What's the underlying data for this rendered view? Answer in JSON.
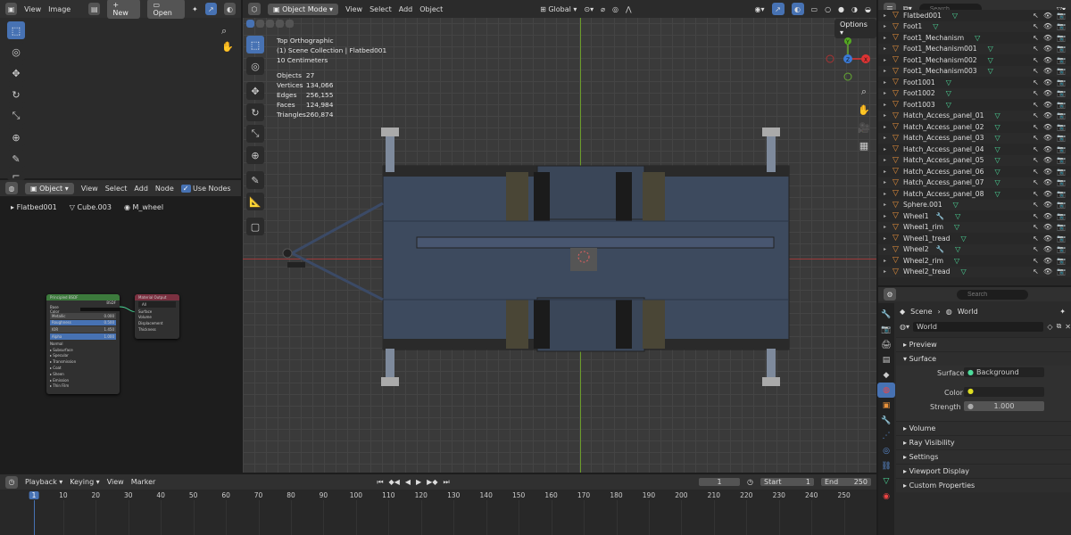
{
  "image_editor": {
    "menu": [
      "View",
      "Image"
    ],
    "new_label": "New",
    "open_label": "Open"
  },
  "node_editor": {
    "mode": "Object",
    "menu": [
      "View",
      "Select",
      "Add",
      "Node"
    ],
    "use_nodes": "Use Nodes",
    "breadcrumb": [
      "Flatbed001",
      "Cube.003",
      "M_wheel"
    ],
    "bsdf": {
      "title": "Principled BSDF",
      "rows": [
        "Base Color",
        "Metallic",
        "Roughness",
        "IOR",
        "Alpha",
        "Normal",
        "Subsurface",
        "Specular",
        "Transmission",
        "Coat",
        "Sheen",
        "Emission",
        "Thin Film"
      ],
      "values": {
        "metallic": "0.000",
        "roughness": "0.500",
        "ior": "1.450",
        "alpha": "1.000"
      },
      "bsdf_label": "BSDF"
    },
    "output": {
      "title": "Material Output",
      "target": "All",
      "rows": [
        "Surface",
        "Volume",
        "Displacement",
        "Thickness"
      ]
    }
  },
  "viewport": {
    "mode": "Object Mode",
    "menu": [
      "View",
      "Select",
      "Add",
      "Object"
    ],
    "orientation": "Global",
    "options": "Options",
    "overlay": {
      "view": "Top Orthographic",
      "collection": "(1) Scene Collection | Flatbed001",
      "scale": "10 Centimeters"
    },
    "stats": [
      [
        "Objects",
        "27"
      ],
      [
        "Vertices",
        "134,066"
      ],
      [
        "Edges",
        "256,155"
      ],
      [
        "Faces",
        "124,984"
      ],
      [
        "Triangles",
        "260,874"
      ]
    ],
    "gizmo": {
      "x": "X",
      "y": "Y",
      "z": "Z"
    }
  },
  "outliner": {
    "search_placeholder": "Search",
    "items": [
      "Flatbed001",
      "Foot1",
      "Foot1_Mechanism",
      "Foot1_Mechanism001",
      "Foot1_Mechanism002",
      "Foot1_Mechanism003",
      "Foot1001",
      "Foot1002",
      "Foot1003",
      "Hatch_Access_panel_01",
      "Hatch_Access_panel_02",
      "Hatch_Access_panel_03",
      "Hatch_Access_panel_04",
      "Hatch_Access_panel_05",
      "Hatch_Access_panel_06",
      "Hatch_Access_panel_07",
      "Hatch_Access_panel_08",
      "Sphere.001",
      "Wheel1",
      "Wheel1_rim",
      "Wheel1_tread",
      "Wheel2",
      "Wheel2_rim",
      "Wheel2_tread"
    ]
  },
  "properties": {
    "search_placeholder": "Search",
    "breadcrumb": [
      "Scene",
      "World"
    ],
    "world_name": "World",
    "sections": [
      "Preview",
      "Surface",
      "Volume",
      "Ray Visibility",
      "Settings",
      "Viewport Display",
      "Custom Properties"
    ],
    "surface_label": "Surface",
    "surface_value": "Background",
    "color_label": "Color",
    "strength_label": "Strength",
    "strength_value": "1.000"
  },
  "timeline": {
    "menu": [
      "Playback",
      "Keying",
      "View",
      "Marker"
    ],
    "current_frame": "1",
    "start_label": "Start",
    "start_value": "1",
    "end_label": "End",
    "end_value": "250",
    "ticks": [
      "1",
      "10",
      "20",
      "30",
      "40",
      "50",
      "60",
      "70",
      "80",
      "90",
      "100",
      "110",
      "120",
      "130",
      "140",
      "150",
      "160",
      "170",
      "180",
      "190",
      "200",
      "210",
      "220",
      "230",
      "240",
      "250"
    ]
  }
}
